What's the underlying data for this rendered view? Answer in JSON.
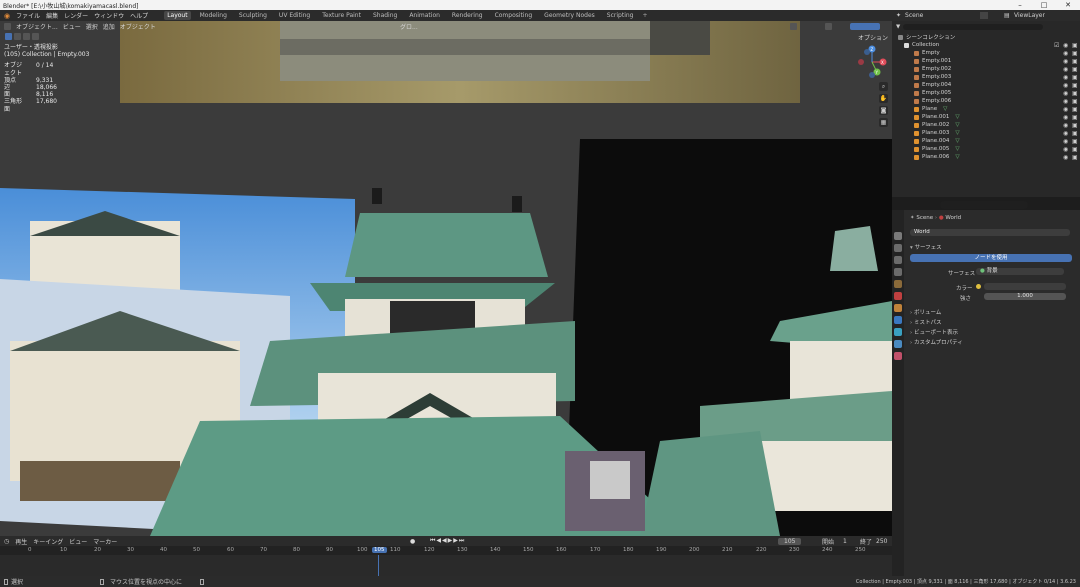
{
  "window": {
    "title": "Blender* [E:\\小牧山城\\komakiyamacasl.blend]",
    "controls": [
      "–",
      "□",
      "✕"
    ]
  },
  "menubar": {
    "menus": [
      "ファイル",
      "編集",
      "レンダー",
      "ウィンドウ",
      "ヘルプ"
    ],
    "workspaces": [
      "Layout",
      "Modeling",
      "Sculpting",
      "UV Editing",
      "Texture Paint",
      "Shading",
      "Animation",
      "Rendering",
      "Compositing",
      "Geometry Nodes",
      "Scripting"
    ],
    "active_workspace": "Layout",
    "scene": "Scene",
    "view_layer": "ViewLayer"
  },
  "viewport": {
    "mode": "オブジェクト...",
    "menus": [
      "ビュー",
      "選択",
      "追加",
      "オブジェクト"
    ],
    "transform_orientation": "グロ...",
    "options_label": "オプション",
    "stats": {
      "view_name": "ユーザー・透視投影",
      "collection": "(105) Collection | Empty.003",
      "rows": [
        {
          "k": "オブジェクト",
          "v": "0 / 14"
        },
        {
          "k": "頂点",
          "v": "9,331"
        },
        {
          "k": "辺",
          "v": "18,066"
        },
        {
          "k": "面",
          "v": "8,116"
        },
        {
          "k": "三角形面",
          "v": "17,680"
        }
      ]
    },
    "gizmo": {
      "x": "X",
      "y": "Y",
      "z": "Z"
    }
  },
  "timeline": {
    "menus": [
      "再生",
      "キーイング",
      "ビュー",
      "マーカー"
    ],
    "current_frame": "105",
    "start_label": "開始",
    "start": "1",
    "end_label": "終了",
    "end": "250",
    "ticks": [
      "0",
      "10",
      "20",
      "30",
      "40",
      "50",
      "60",
      "70",
      "80",
      "90",
      "100",
      "105",
      "110",
      "120",
      "130",
      "140",
      "150",
      "160",
      "170",
      "180",
      "190",
      "200",
      "210",
      "220",
      "230",
      "240",
      "250"
    ]
  },
  "statusbar": {
    "left": "選択",
    "middle": "マウス位置を視点の中心に",
    "right": "Collection | Empty.003 | 頂点 9,331 | 面 8,116 | 三角形 17,680 | オブジェクト 0/14 | 3.6.23"
  },
  "outliner": {
    "root": "シーンコレクション",
    "collection": "Collection",
    "items": [
      {
        "name": "Empty",
        "type": "empty"
      },
      {
        "name": "Empty.001",
        "type": "empty"
      },
      {
        "name": "Empty.002",
        "type": "empty"
      },
      {
        "name": "Empty.003",
        "type": "empty"
      },
      {
        "name": "Empty.004",
        "type": "empty"
      },
      {
        "name": "Empty.005",
        "type": "empty"
      },
      {
        "name": "Empty.006",
        "type": "empty"
      },
      {
        "name": "Plane",
        "type": "mesh"
      },
      {
        "name": "Plane.001",
        "type": "mesh"
      },
      {
        "name": "Plane.002",
        "type": "mesh"
      },
      {
        "name": "Plane.003",
        "type": "mesh"
      },
      {
        "name": "Plane.004",
        "type": "mesh"
      },
      {
        "name": "Plane.005",
        "type": "mesh"
      },
      {
        "name": "Plane.006",
        "type": "mesh"
      }
    ]
  },
  "properties": {
    "breadcrumb_scene": "Scene",
    "breadcrumb_world": "World",
    "world_name": "World",
    "surface_panel": "サーフェス",
    "use_nodes_button": "ノードを使用",
    "surface_label": "サーフェス",
    "surface_value": "背景",
    "color_label": "カラー",
    "strength_label": "強さ",
    "strength_value": "1.000",
    "panels": [
      "ボリューム",
      "ミストパス",
      "ビューポート表示",
      "カスタムプロパティ"
    ]
  },
  "colors": {
    "accent": "#4772b3",
    "empty_icon": "#c07a4a",
    "mesh_icon": "#6ec27a",
    "roof": "#4f8a72"
  }
}
